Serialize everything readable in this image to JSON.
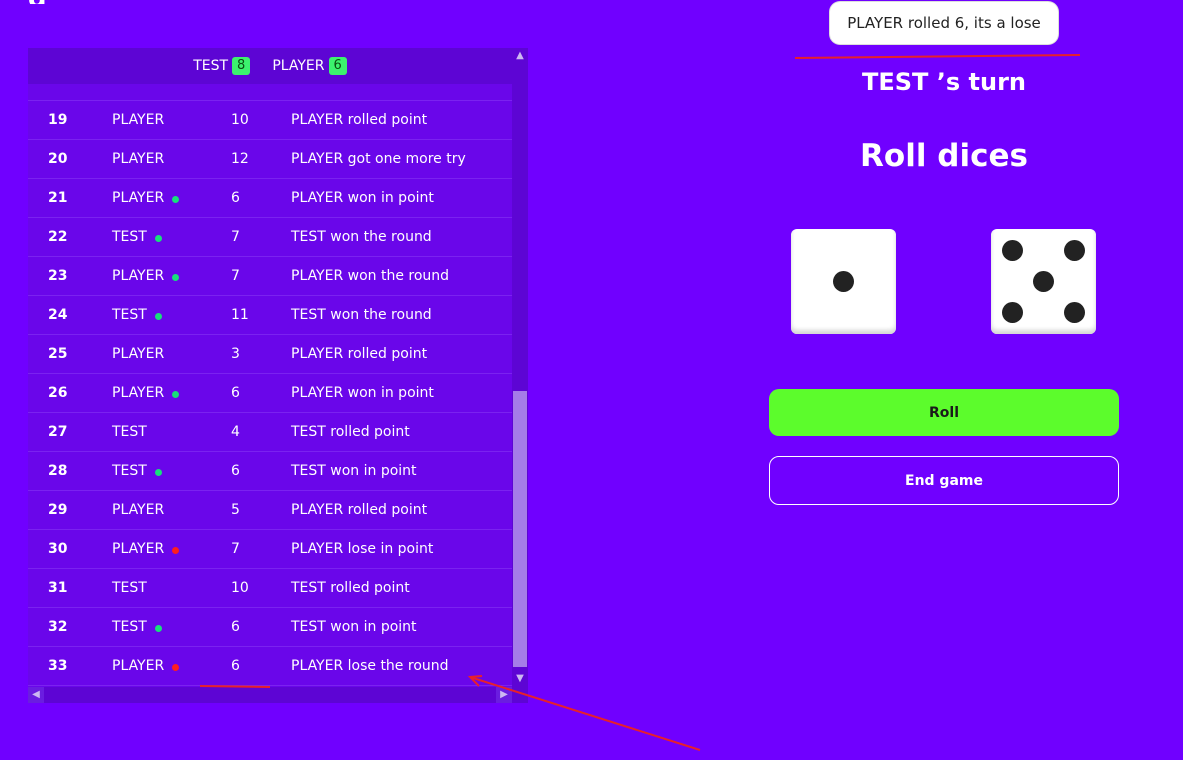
{
  "app": {
    "title_fragment": "g"
  },
  "scoreboard": {
    "players": [
      {
        "name": "TEST",
        "score": "8"
      },
      {
        "name": "PLAYER",
        "score": "6"
      }
    ],
    "rows": [
      {
        "num": "19",
        "player": "PLAYER",
        "dot": "",
        "roll": "10",
        "message": "PLAYER rolled point"
      },
      {
        "num": "20",
        "player": "PLAYER",
        "dot": "",
        "roll": "12",
        "message": "PLAYER got one more try"
      },
      {
        "num": "21",
        "player": "PLAYER",
        "dot": "green",
        "roll": "6",
        "message": "PLAYER won in point"
      },
      {
        "num": "22",
        "player": "TEST",
        "dot": "green",
        "roll": "7",
        "message": "TEST won the round"
      },
      {
        "num": "23",
        "player": "PLAYER",
        "dot": "green",
        "roll": "7",
        "message": "PLAYER won the round"
      },
      {
        "num": "24",
        "player": "TEST",
        "dot": "green",
        "roll": "11",
        "message": "TEST won the round"
      },
      {
        "num": "25",
        "player": "PLAYER",
        "dot": "",
        "roll": "3",
        "message": "PLAYER rolled point"
      },
      {
        "num": "26",
        "player": "PLAYER",
        "dot": "green",
        "roll": "6",
        "message": "PLAYER won in point"
      },
      {
        "num": "27",
        "player": "TEST",
        "dot": "",
        "roll": "4",
        "message": "TEST rolled point"
      },
      {
        "num": "28",
        "player": "TEST",
        "dot": "green",
        "roll": "6",
        "message": "TEST won in point"
      },
      {
        "num": "29",
        "player": "PLAYER",
        "dot": "",
        "roll": "5",
        "message": "PLAYER rolled point"
      },
      {
        "num": "30",
        "player": "PLAYER",
        "dot": "red",
        "roll": "7",
        "message": "PLAYER lose in point"
      },
      {
        "num": "31",
        "player": "TEST",
        "dot": "",
        "roll": "10",
        "message": "TEST rolled point"
      },
      {
        "num": "32",
        "player": "TEST",
        "dot": "green",
        "roll": "6",
        "message": "TEST won in point"
      },
      {
        "num": "33",
        "player": "PLAYER",
        "dot": "red",
        "roll": "6",
        "message": "PLAYER lose the round"
      }
    ]
  },
  "toast": {
    "text": "PLAYER rolled 6, its a lose"
  },
  "turn": {
    "text": "TEST ’s turn"
  },
  "roll_title": "Roll dices",
  "dice": [
    1,
    5
  ],
  "buttons": {
    "roll": "Roll",
    "end": "End game"
  },
  "colors": {
    "background": "#7000ff",
    "win_dot": "#18e07a",
    "lose_dot": "#ff1e1e",
    "roll_button": "#5cfc2c",
    "score_badge": "#3cf26e",
    "annotation": "#e8202a"
  }
}
